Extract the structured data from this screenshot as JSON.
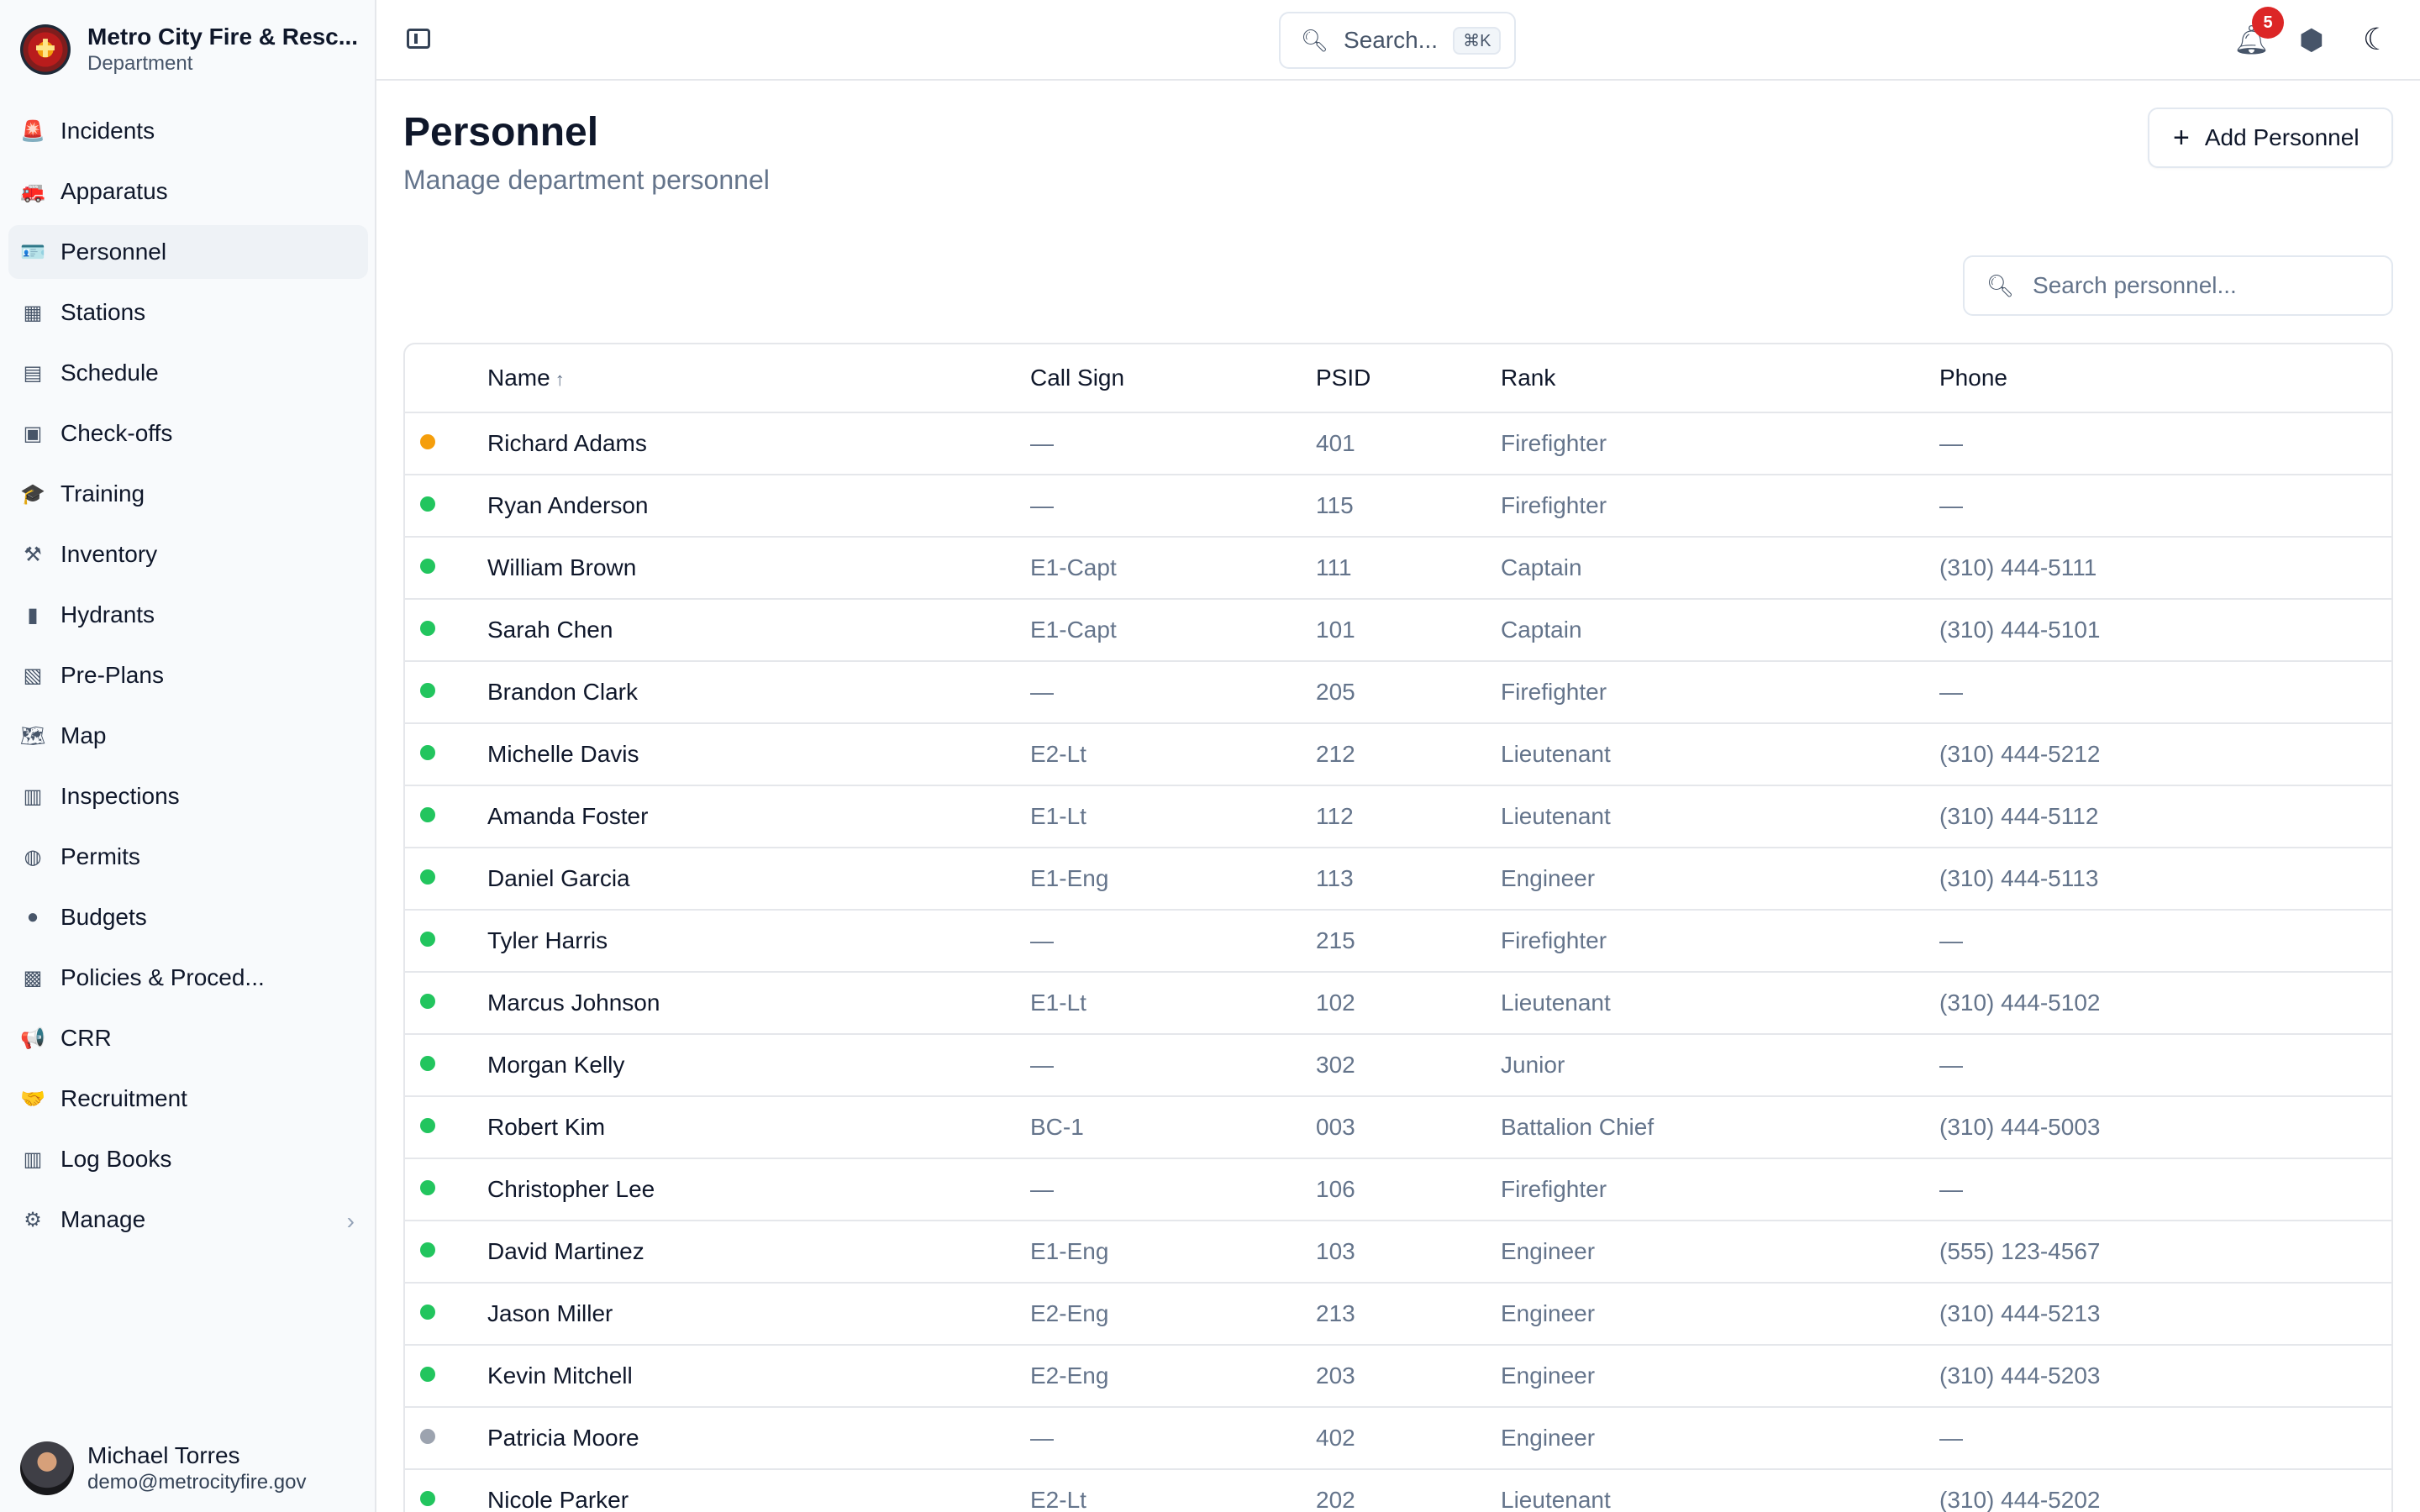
{
  "app": {
    "name": "Metro City Fire & Resc...",
    "subtitle": "Department"
  },
  "nav": [
    {
      "label": "Incidents",
      "icon": "siren-icon",
      "glyph": "🚨",
      "active": false
    },
    {
      "label": "Apparatus",
      "icon": "truck-icon",
      "glyph": "🚒",
      "active": false
    },
    {
      "label": "Personnel",
      "icon": "id-card-icon",
      "glyph": "🪪",
      "active": true
    },
    {
      "label": "Stations",
      "icon": "building-icon",
      "glyph": "▦",
      "active": false
    },
    {
      "label": "Schedule",
      "icon": "calendar-icon",
      "glyph": "▤",
      "active": false
    },
    {
      "label": "Check-offs",
      "icon": "clipboard-icon",
      "glyph": "▣",
      "active": false
    },
    {
      "label": "Training",
      "icon": "graduation-cap-icon",
      "glyph": "🎓",
      "active": false
    },
    {
      "label": "Inventory",
      "icon": "hammer-icon",
      "glyph": "⚒",
      "active": false
    },
    {
      "label": "Hydrants",
      "icon": "hydrant-icon",
      "glyph": "▮",
      "active": false
    },
    {
      "label": "Pre-Plans",
      "icon": "building-shield-icon",
      "glyph": "▧",
      "active": false
    },
    {
      "label": "Map",
      "icon": "map-icon",
      "glyph": "🗺",
      "active": false
    },
    {
      "label": "Inspections",
      "icon": "clipboard-check-icon",
      "glyph": "▥",
      "active": false
    },
    {
      "label": "Permits",
      "icon": "stamp-icon",
      "glyph": "◍",
      "active": false
    },
    {
      "label": "Budgets",
      "icon": "piggy-bank-icon",
      "glyph": "●",
      "active": false
    },
    {
      "label": "Policies & Proced...",
      "icon": "book-icon",
      "glyph": "▩",
      "active": false
    },
    {
      "label": "CRR",
      "icon": "megaphone-icon",
      "glyph": "📢",
      "active": false
    },
    {
      "label": "Recruitment",
      "icon": "handshake-icon",
      "glyph": "🤝",
      "active": false
    },
    {
      "label": "Log Books",
      "icon": "books-icon",
      "glyph": "▥",
      "active": false
    }
  ],
  "manage": {
    "label": "Manage",
    "icon": "gear-icon",
    "glyph": "⚙",
    "chevron": "›"
  },
  "user": {
    "name": "Michael Torres",
    "email": "demo@metrocityfire.gov"
  },
  "topbar": {
    "search_label": "Search...",
    "search_shortcut": "⌘K",
    "notification_count": "5"
  },
  "page": {
    "title": "Personnel",
    "subtitle": "Manage department personnel",
    "add_button": "Add Personnel",
    "search_placeholder": "Search personnel..."
  },
  "table": {
    "columns": {
      "name": "Name",
      "call_sign": "Call Sign",
      "psid": "PSID",
      "rank": "Rank",
      "phone": "Phone"
    },
    "sort_indicator": "↑",
    "status_colors": {
      "on_leave": "#f59e0b",
      "active": "#22c55e",
      "inactive": "#9ca3af"
    },
    "rows": [
      {
        "status": "on_leave",
        "name": "Richard Adams",
        "call_sign": "—",
        "psid": "401",
        "rank": "Firefighter",
        "phone": "—"
      },
      {
        "status": "active",
        "name": "Ryan Anderson",
        "call_sign": "—",
        "psid": "115",
        "rank": "Firefighter",
        "phone": "—"
      },
      {
        "status": "active",
        "name": "William Brown",
        "call_sign": "E1-Capt",
        "psid": "111",
        "rank": "Captain",
        "phone": "(310) 444-5111"
      },
      {
        "status": "active",
        "name": "Sarah Chen",
        "call_sign": "E1-Capt",
        "psid": "101",
        "rank": "Captain",
        "phone": "(310) 444-5101"
      },
      {
        "status": "active",
        "name": "Brandon Clark",
        "call_sign": "—",
        "psid": "205",
        "rank": "Firefighter",
        "phone": "—"
      },
      {
        "status": "active",
        "name": "Michelle Davis",
        "call_sign": "E2-Lt",
        "psid": "212",
        "rank": "Lieutenant",
        "phone": "(310) 444-5212"
      },
      {
        "status": "active",
        "name": "Amanda Foster",
        "call_sign": "E1-Lt",
        "psid": "112",
        "rank": "Lieutenant",
        "phone": "(310) 444-5112"
      },
      {
        "status": "active",
        "name": "Daniel Garcia",
        "call_sign": "E1-Eng",
        "psid": "113",
        "rank": "Engineer",
        "phone": "(310) 444-5113"
      },
      {
        "status": "active",
        "name": "Tyler Harris",
        "call_sign": "—",
        "psid": "215",
        "rank": "Firefighter",
        "phone": "—"
      },
      {
        "status": "active",
        "name": "Marcus Johnson",
        "call_sign": "E1-Lt",
        "psid": "102",
        "rank": "Lieutenant",
        "phone": "(310) 444-5102"
      },
      {
        "status": "active",
        "name": "Morgan Kelly",
        "call_sign": "—",
        "psid": "302",
        "rank": "Junior",
        "phone": "—"
      },
      {
        "status": "active",
        "name": "Robert Kim",
        "call_sign": "BC-1",
        "psid": "003",
        "rank": "Battalion Chief",
        "phone": "(310) 444-5003"
      },
      {
        "status": "active",
        "name": "Christopher Lee",
        "call_sign": "—",
        "psid": "106",
        "rank": "Firefighter",
        "phone": "—"
      },
      {
        "status": "active",
        "name": "David Martinez",
        "call_sign": "E1-Eng",
        "psid": "103",
        "rank": "Engineer",
        "phone": "(555) 123-4567"
      },
      {
        "status": "active",
        "name": "Jason Miller",
        "call_sign": "E2-Eng",
        "psid": "213",
        "rank": "Engineer",
        "phone": "(310) 444-5213"
      },
      {
        "status": "active",
        "name": "Kevin Mitchell",
        "call_sign": "E2-Eng",
        "psid": "203",
        "rank": "Engineer",
        "phone": "(310) 444-5203"
      },
      {
        "status": "inactive",
        "name": "Patricia Moore",
        "call_sign": "—",
        "psid": "402",
        "rank": "Engineer",
        "phone": "—"
      },
      {
        "status": "active",
        "name": "Nicole Parker",
        "call_sign": "E2-Lt",
        "psid": "202",
        "rank": "Lieutenant",
        "phone": "(310) 444-5202"
      }
    ]
  }
}
